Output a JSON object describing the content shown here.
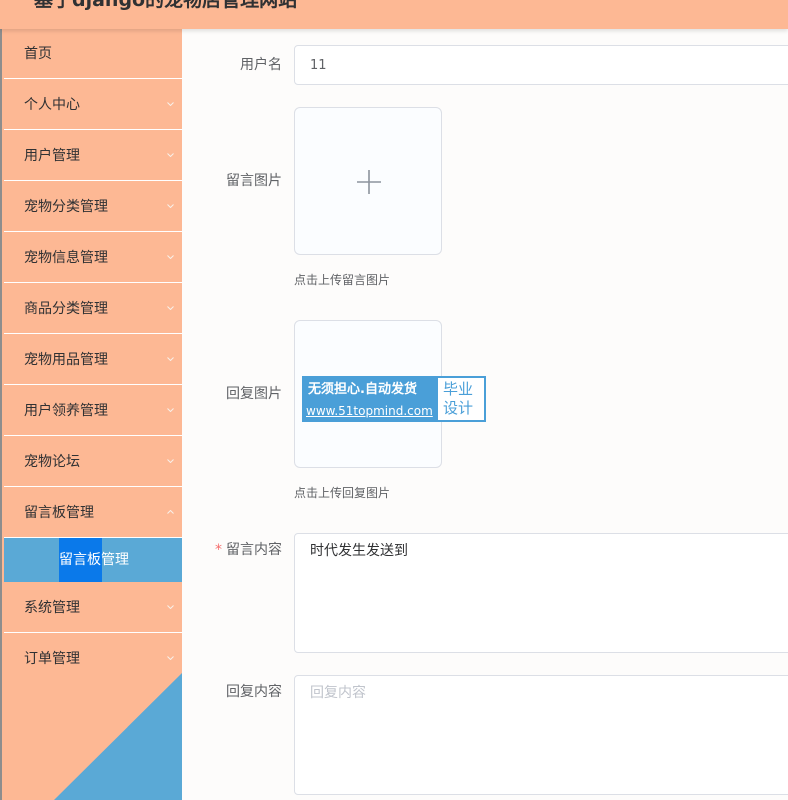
{
  "header": {
    "title": "基于django的宠物店管理网站"
  },
  "sidebar": {
    "items": [
      {
        "label": "首页",
        "has_arrow": false
      },
      {
        "label": "个人中心",
        "has_arrow": true
      },
      {
        "label": "用户管理",
        "has_arrow": true
      },
      {
        "label": "宠物分类管理",
        "has_arrow": true
      },
      {
        "label": "宠物信息管理",
        "has_arrow": true
      },
      {
        "label": "商品分类管理",
        "has_arrow": true
      },
      {
        "label": "宠物用品管理",
        "has_arrow": true
      },
      {
        "label": "用户领养管理",
        "has_arrow": true
      },
      {
        "label": "宠物论坛",
        "has_arrow": true
      },
      {
        "label": "留言板管理",
        "has_arrow": true,
        "expanded": true
      }
    ],
    "active_submenu": {
      "label": "留言板管理"
    },
    "items_after": [
      {
        "label": "系统管理",
        "has_arrow": true
      },
      {
        "label": "订单管理",
        "has_arrow": true
      }
    ]
  },
  "form": {
    "username": {
      "label": "用户名",
      "value": "11"
    },
    "message_image": {
      "label": "留言图片",
      "tip": "点击上传留言图片"
    },
    "reply_image": {
      "label": "回复图片",
      "tip": "点击上传回复图片"
    },
    "message_content": {
      "label": "留言内容",
      "required_mark": "*",
      "value": "时代发生发送到"
    },
    "reply_content": {
      "label": "回复内容",
      "placeholder": "回复内容"
    }
  },
  "watermark": {
    "line1": "无须担心.自动发货",
    "line2": "www.51topmind.com",
    "right_top": "毕业",
    "right_bottom": "设计"
  },
  "colors": {
    "header_bg": "#fdb894",
    "sidebar_bg": "#fdb894",
    "sidebar_corner": "#5aa9d6",
    "submenu_bg": "#5aa9d6",
    "submenu_highlight": "#0a79ea",
    "required": "#f56c6c",
    "watermark": "#4a9fd8"
  }
}
